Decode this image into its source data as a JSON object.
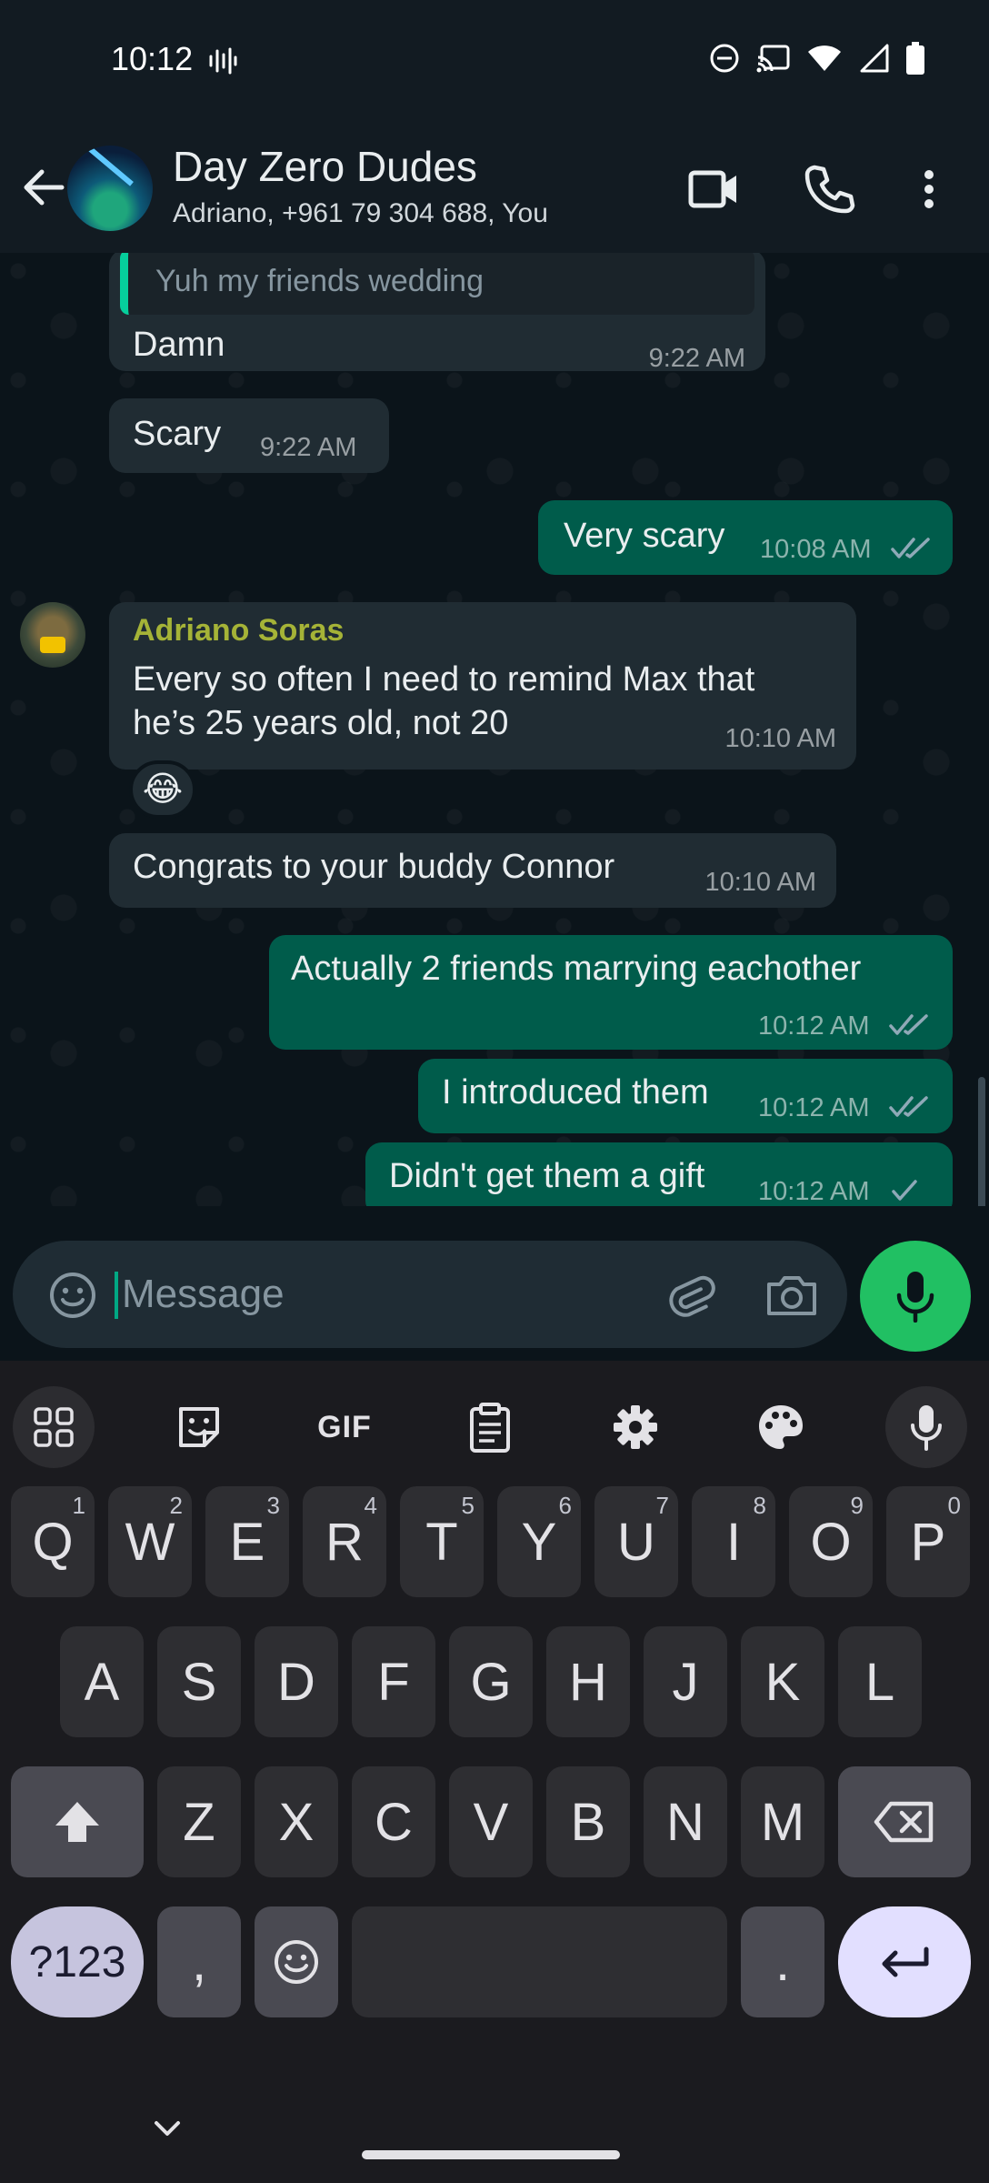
{
  "status_bar": {
    "time": "10:12"
  },
  "header": {
    "title": "Day Zero Dudes",
    "subtitle": "Adriano, +961 79 304 688, You"
  },
  "messages": [
    {
      "quote": "Yuh my friends wedding",
      "text": "Damn",
      "time": "9:22 AM"
    },
    {
      "text": "Scary",
      "time": "9:22 AM"
    },
    {
      "text": "Very scary",
      "time": "10:08 AM",
      "status": "read"
    },
    {
      "sender": "Adriano Soras",
      "line1": "Every so often I need to remind Max that",
      "line2": "he’s 25 years old, not 20",
      "time": "10:10 AM",
      "reaction": "😂"
    },
    {
      "text": "Congrats to your buddy Connor",
      "time": "10:10 AM"
    },
    {
      "text": "Actually 2 friends marrying eachother",
      "time": "10:12 AM",
      "status": "read"
    },
    {
      "text": "I introduced them",
      "time": "10:12 AM",
      "status": "read"
    },
    {
      "text": "Didn't get them a gift",
      "time": "10:12 AM",
      "status": "sent"
    }
  ],
  "composer": {
    "placeholder": "Message",
    "value": ""
  },
  "keyboard": {
    "toolbar": {
      "gif": "GIF"
    },
    "row1": [
      {
        "key": "Q",
        "hint": "1"
      },
      {
        "key": "W",
        "hint": "2"
      },
      {
        "key": "E",
        "hint": "3"
      },
      {
        "key": "R",
        "hint": "4"
      },
      {
        "key": "T",
        "hint": "5"
      },
      {
        "key": "Y",
        "hint": "6"
      },
      {
        "key": "U",
        "hint": "7"
      },
      {
        "key": "I",
        "hint": "8"
      },
      {
        "key": "O",
        "hint": "9"
      },
      {
        "key": "P",
        "hint": "0"
      }
    ],
    "row2": [
      "A",
      "S",
      "D",
      "F",
      "G",
      "H",
      "J",
      "K",
      "L"
    ],
    "row3": [
      "Z",
      "X",
      "C",
      "V",
      "B",
      "N",
      "M"
    ],
    "symbols_key": "?123",
    "comma_key": ",",
    "period_key": "."
  },
  "colors": {
    "incoming_bubble": "#202c33",
    "outgoing_bubble": "#005c4b",
    "accent": "#21c063",
    "sender_name": "#a5b337",
    "read_ticks": "#8fa9b7"
  },
  "icons": {
    "status_bar": [
      "sound-wave-icon",
      "do-not-disturb-icon",
      "cast-icon",
      "wifi-icon",
      "signal-icon",
      "battery-icon"
    ],
    "header": [
      "back-arrow-icon",
      "video-call-icon",
      "voice-call-icon",
      "more-vert-icon"
    ],
    "composer": [
      "emoji-icon",
      "attach-icon",
      "camera-icon",
      "mic-icon"
    ],
    "keyboard_toolbar": [
      "apps-grid-icon",
      "sticker-icon",
      "clipboard-icon",
      "settings-icon",
      "palette-icon",
      "voice-input-icon"
    ]
  }
}
